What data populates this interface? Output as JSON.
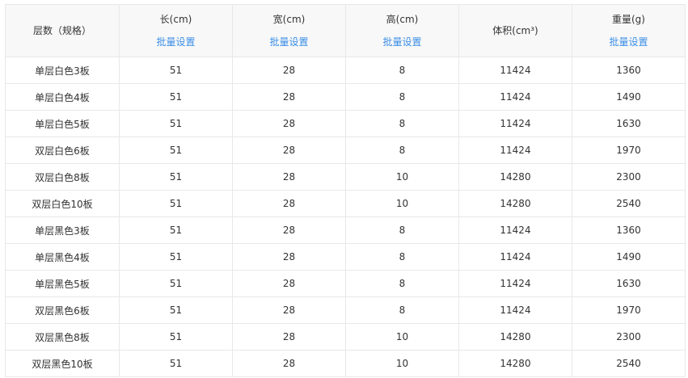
{
  "table": {
    "headers": {
      "spec": "层数（规格）",
      "length": "长(cm)",
      "width": "宽(cm)",
      "height": "高(cm)",
      "volume": "体积(cm³)",
      "weight": "重量(g)"
    },
    "batch_label": "批量设置",
    "colors": {
      "link": "#3a8ee6",
      "header_bg": "#f8f8f8",
      "border": "#e8e8e8",
      "text": "#333333"
    },
    "rows": [
      {
        "spec": "单层白色3板",
        "length": "51",
        "width": "28",
        "height": "8",
        "volume": "11424",
        "weight": "1360"
      },
      {
        "spec": "单层白色4板",
        "length": "51",
        "width": "28",
        "height": "8",
        "volume": "11424",
        "weight": "1490"
      },
      {
        "spec": "单层白色5板",
        "length": "51",
        "width": "28",
        "height": "8",
        "volume": "11424",
        "weight": "1630"
      },
      {
        "spec": "双层白色6板",
        "length": "51",
        "width": "28",
        "height": "8",
        "volume": "11424",
        "weight": "1970"
      },
      {
        "spec": "双层白色8板",
        "length": "51",
        "width": "28",
        "height": "10",
        "volume": "14280",
        "weight": "2300"
      },
      {
        "spec": "双层白色10板",
        "length": "51",
        "width": "28",
        "height": "10",
        "volume": "14280",
        "weight": "2540"
      },
      {
        "spec": "单层黑色3板",
        "length": "51",
        "width": "28",
        "height": "8",
        "volume": "11424",
        "weight": "1360"
      },
      {
        "spec": "单层黑色4板",
        "length": "51",
        "width": "28",
        "height": "8",
        "volume": "11424",
        "weight": "1490"
      },
      {
        "spec": "单层黑色5板",
        "length": "51",
        "width": "28",
        "height": "8",
        "volume": "11424",
        "weight": "1630"
      },
      {
        "spec": "双层黑色6板",
        "length": "51",
        "width": "28",
        "height": "8",
        "volume": "11424",
        "weight": "1970"
      },
      {
        "spec": "双层黑色8板",
        "length": "51",
        "width": "28",
        "height": "10",
        "volume": "14280",
        "weight": "2300"
      },
      {
        "spec": "双层黑色10板",
        "length": "51",
        "width": "28",
        "height": "10",
        "volume": "14280",
        "weight": "2540"
      }
    ]
  }
}
